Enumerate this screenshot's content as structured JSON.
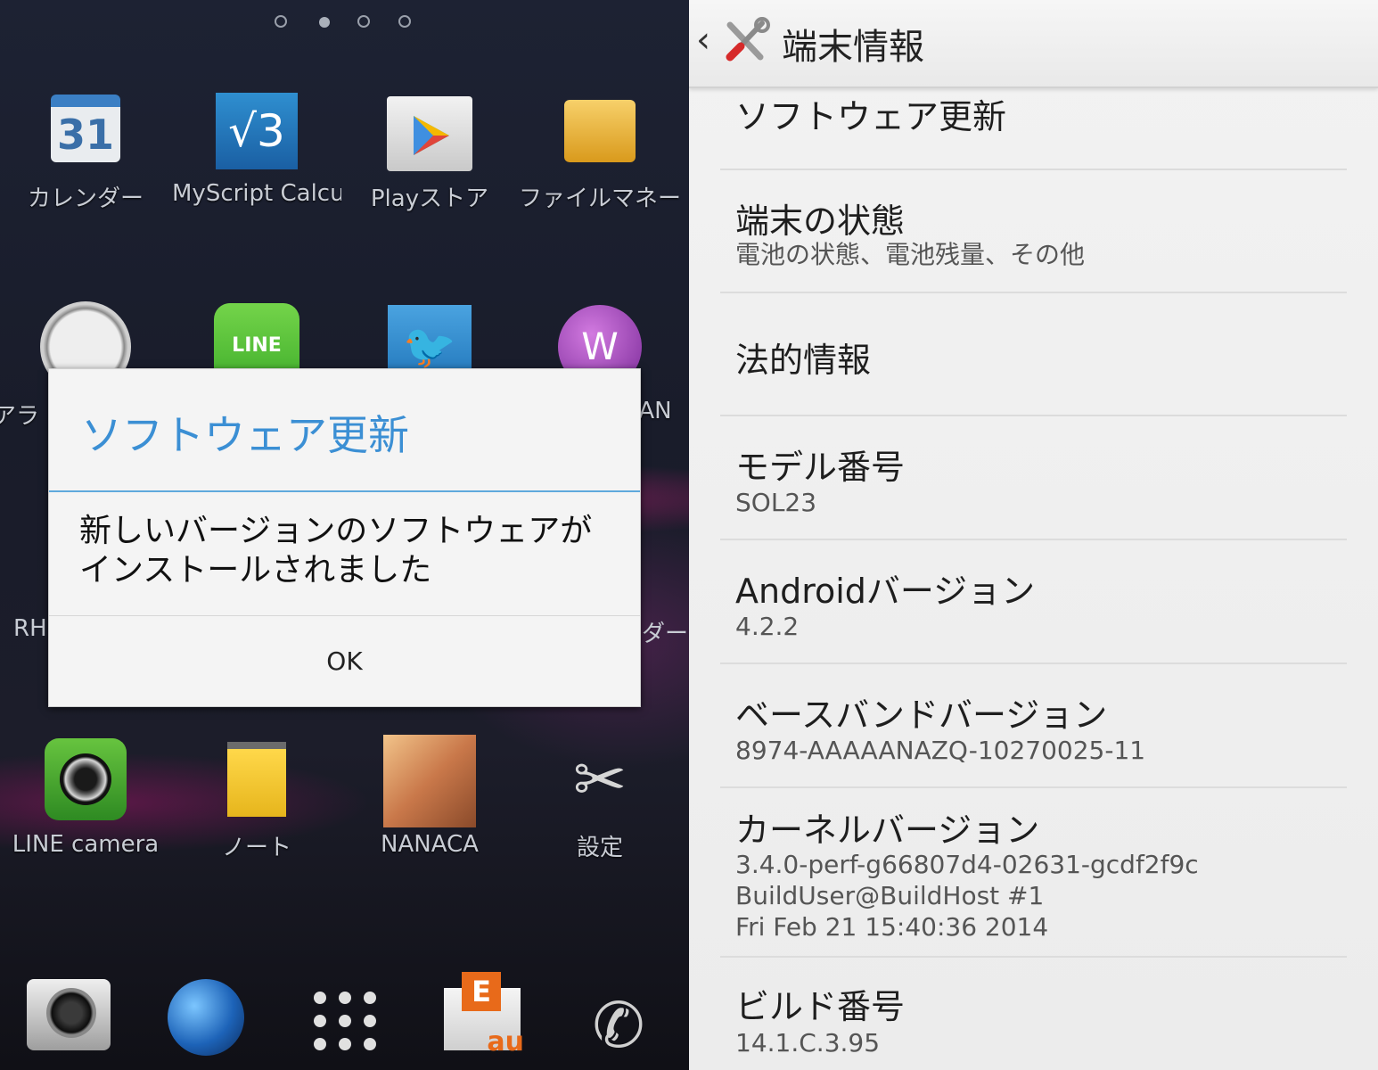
{
  "home": {
    "page_indicator": {
      "count": 4,
      "active": 1
    },
    "apps_row1": [
      {
        "label": "カレンダー",
        "icon": "calendar-icon",
        "icon_text": "31"
      },
      {
        "label": "MyScript Calcu",
        "icon": "calculator-icon",
        "icon_text": "√3"
      },
      {
        "label": "Playストア",
        "icon": "play-store-icon"
      },
      {
        "label": "ファイルマネー",
        "icon": "file-manager-icon"
      }
    ],
    "apps_row2": [
      {
        "label": "アラ",
        "icon": "clock-icon"
      },
      {
        "label": "",
        "icon": "line-icon",
        "icon_text": "LINE"
      },
      {
        "label": "",
        "icon": "twitter-icon"
      },
      {
        "label": "AN",
        "icon": "walkman-icon",
        "icon_text": "W"
      }
    ],
    "peek_row3": {
      "left": "RH",
      "right": "ダー"
    },
    "apps_row4": [
      {
        "label": "LINE camera",
        "icon": "line-camera-icon"
      },
      {
        "label": "ノート",
        "icon": "note-icon"
      },
      {
        "label": "NANACA",
        "icon": "nanaca-icon"
      },
      {
        "label": "設定",
        "icon": "settings-icon"
      }
    ],
    "dock": {
      "mail_badge": "E",
      "carrier_text": "au"
    }
  },
  "dialog": {
    "title": "ソフトウェア更新",
    "message": "新しいバージョンのソフトウェアがインストールされました",
    "ok_label": "OK"
  },
  "settings": {
    "title": "端末情報",
    "items": [
      {
        "title": "ソフトウェア更新",
        "subtitle": ""
      },
      {
        "title": "端末の状態",
        "subtitle": "電池の状態、電池残量、その他"
      },
      {
        "title": "法的情報",
        "subtitle": ""
      },
      {
        "title": "モデル番号",
        "subtitle": "SOL23"
      },
      {
        "title": "Androidバージョン",
        "subtitle": "4.2.2"
      },
      {
        "title": "ベースバンドバージョン",
        "subtitle": "8974-AAAAANAZQ-10270025-11"
      },
      {
        "title": "カーネルバージョン",
        "subtitle": "3.4.0-perf-g66807d4-02631-gcdf2f9c\nBuildUser@BuildHost #1\nFri Feb 21 15:40:36 2014"
      },
      {
        "title": "ビルド番号",
        "subtitle": "14.1.C.3.95"
      }
    ]
  },
  "colors": {
    "dialog_accent": "#3b8fd4",
    "settings_bg": "#efefef"
  }
}
